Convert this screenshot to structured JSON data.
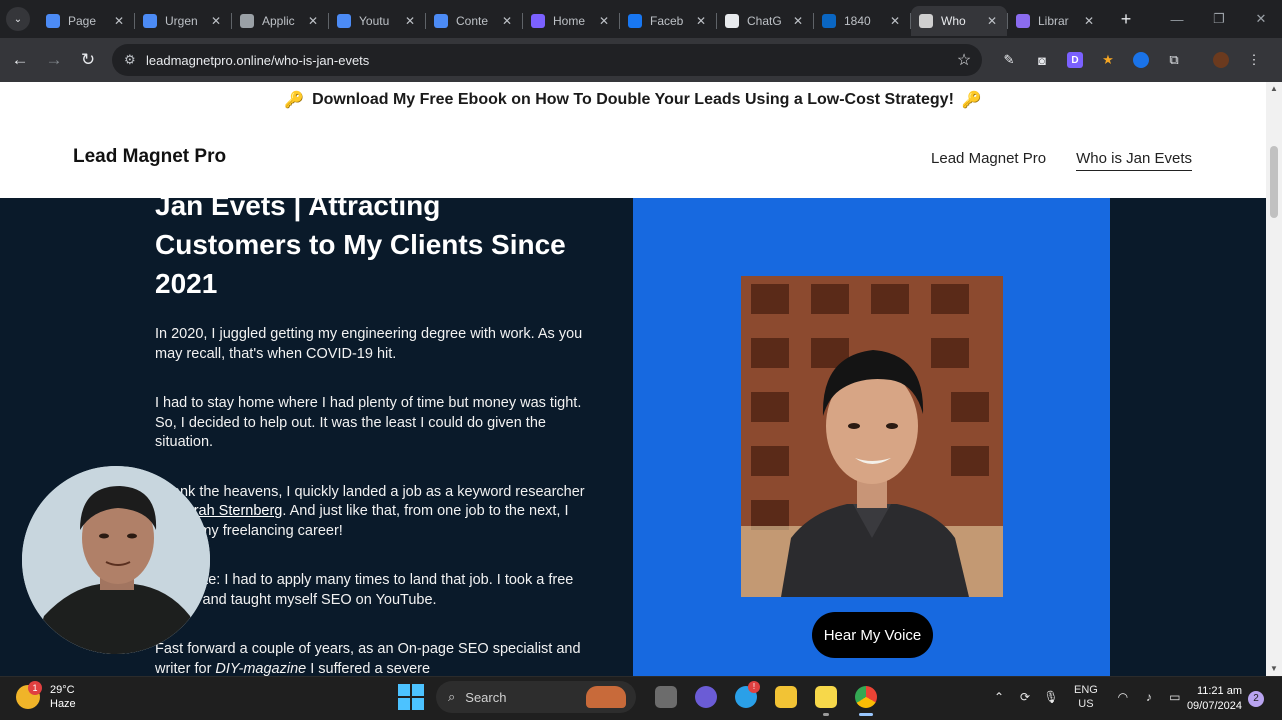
{
  "browser": {
    "tabs": [
      {
        "title": "Page",
        "icon": "page-icon",
        "color": "#4c8bf5"
      },
      {
        "title": "Urgen",
        "icon": "page-icon",
        "color": "#4c8bf5"
      },
      {
        "title": "Applic",
        "icon": "page-icon",
        "color": "#9aa0a6"
      },
      {
        "title": "Youtu",
        "icon": "page-icon",
        "color": "#4c8bf5"
      },
      {
        "title": "Conte",
        "icon": "page-icon",
        "color": "#4c8bf5"
      },
      {
        "title": "Home",
        "icon": "home-icon",
        "color": "#7b61ff"
      },
      {
        "title": "Faceb",
        "icon": "facebook-icon",
        "color": "#1877f2"
      },
      {
        "title": "ChatG",
        "icon": "chatgpt-icon",
        "color": "#e8eaed"
      },
      {
        "title": "1840",
        "icon": "linkedin-icon",
        "color": "#0a66c2"
      },
      {
        "title": "Who",
        "icon": "avatar-icon",
        "color": "#cfcfcf"
      },
      {
        "title": "Librar",
        "icon": "gear-icon",
        "color": "#8b6cf0"
      }
    ],
    "active_tab_index": 9,
    "url": "leadmagnetpro.online/who-is-jan-evets",
    "extension_letter": "D"
  },
  "page": {
    "announcement": "Download My Free Ebook on How To Double Your Leads Using a Low-Cost Strategy!",
    "brand": "Lead Magnet Pro",
    "nav": [
      {
        "label": "Lead Magnet Pro",
        "current": false
      },
      {
        "label": "Who is Jan Evets",
        "current": true
      }
    ],
    "hero": {
      "heading": "Jan Evets | Attracting Customers to My Clients Since 2021",
      "paragraphs": [
        {
          "text": "In 2020, I  juggled getting my engineering degree with work. As you may recall, that's when COVID-19 hit."
        },
        {
          "text": "I had to stay home where I had plenty of time but money was tight. So, I decided to help out. It was the least I could do given the situation."
        },
        {
          "pre": "Thank the heavens, I quickly landed a job as a keyword researcher for ",
          "link": "Sarah Sternberg",
          "post": ". And just like that, from one job to the next, I began my freelancing career!"
        },
        {
          "text": "Side note: I had to apply many times to land that job. I took a free course and taught myself SEO on YouTube."
        },
        {
          "pre": "Fast forward a couple of years, as an On-page SEO specialist and writer for ",
          "em": "DIY-magazine",
          "post": " I suffered a severe"
        }
      ],
      "button": "Hear My Voice",
      "panel_color": "#1769e0"
    }
  },
  "taskbar": {
    "weather_badge": "1",
    "temperature": "29°C",
    "condition": "Haze",
    "search_label": "Search",
    "store_badge": "!",
    "lang_line1": "ENG",
    "lang_line2": "US",
    "time": "11:21 am",
    "date": "09/07/2024",
    "notification_count": "2"
  }
}
